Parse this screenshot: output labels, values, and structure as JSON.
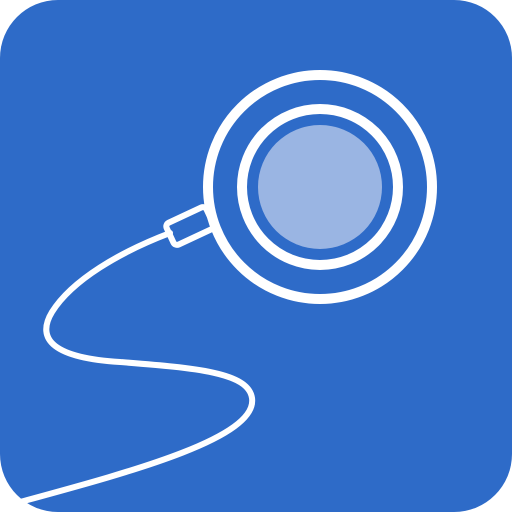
{
  "icon": {
    "name": "app-icon",
    "depicts": "round-light-on-cable-icon",
    "colors": {
      "background": "#2e6bc8",
      "stroke": "#ffffff",
      "lens": "#9ab5e3",
      "page": "#ffffff"
    }
  }
}
